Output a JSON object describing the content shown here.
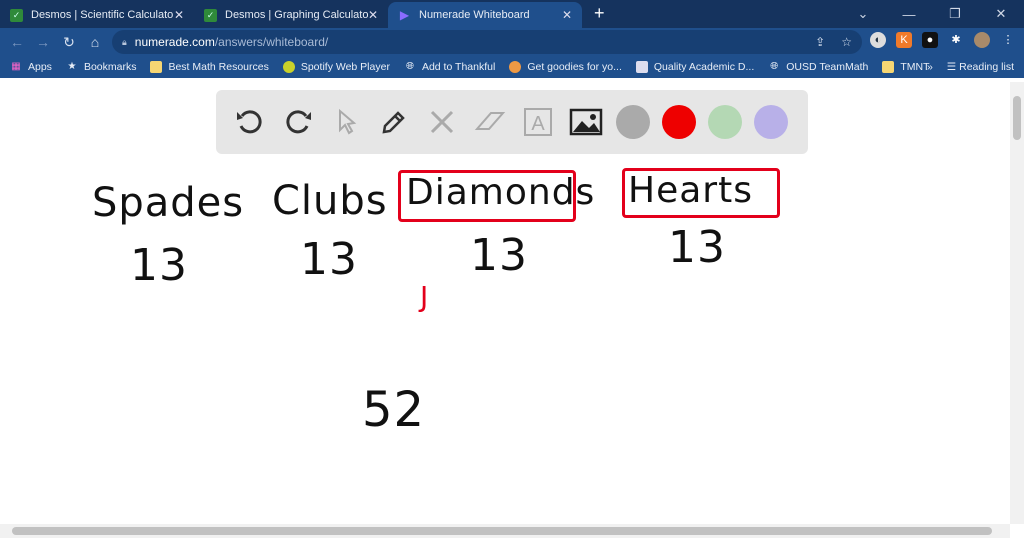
{
  "tabs": [
    {
      "label": "Desmos | Scientific Calculator"
    },
    {
      "label": "Desmos | Graphing Calculator"
    },
    {
      "label": "Numerade Whiteboard",
      "active": true
    }
  ],
  "url": {
    "host": "numerade.com",
    "path": "/answers/whiteboard/"
  },
  "bookmarks": [
    "Apps",
    "Bookmarks",
    "Best Math Resources",
    "Spotify Web Player",
    "Add to Thankful",
    "Get goodies for yo...",
    "Quality Academic D...",
    "OUSD TeamMath",
    "TMNT"
  ],
  "reading_list": "Reading list",
  "whiteboard": {
    "colors": [
      "#aaaaaa",
      "#ee0000",
      "#b4d8b4",
      "#b8b0e8"
    ],
    "suits": [
      {
        "name": "Spades",
        "count": "13"
      },
      {
        "name": "Clubs",
        "count": "13"
      },
      {
        "name": "Diamonds",
        "count": "13"
      },
      {
        "name": "Hearts",
        "count": "13"
      }
    ],
    "mark": "J",
    "total": "52"
  }
}
